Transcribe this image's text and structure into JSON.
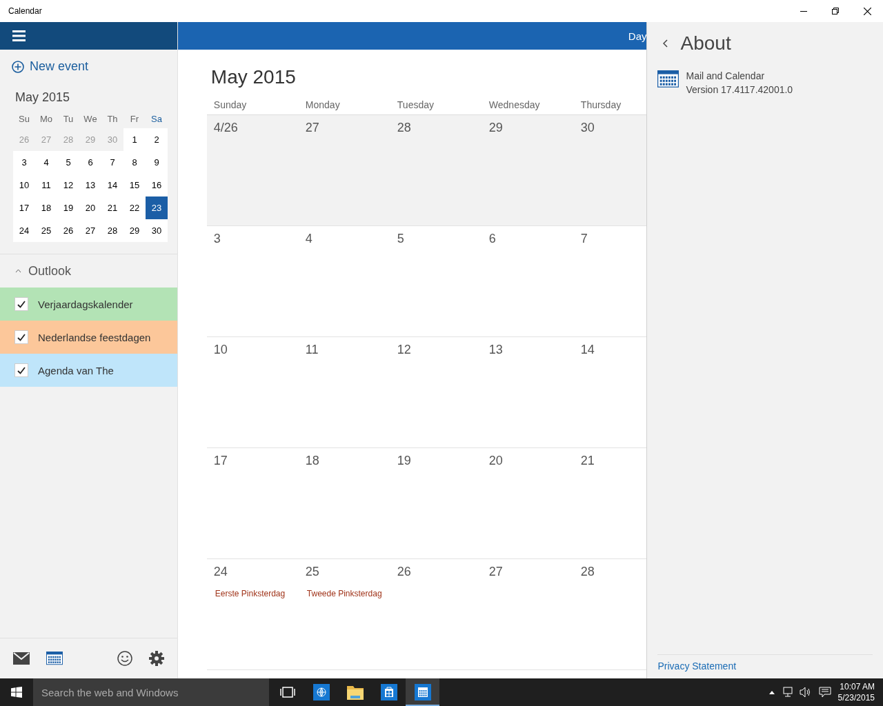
{
  "title_bar": {
    "title": "Calendar",
    "controls": [
      {
        "kind": "minimize"
      },
      {
        "kind": "restore"
      },
      {
        "kind": "close"
      }
    ]
  },
  "sidebar": {
    "new_event": "New event",
    "mini_calendar": {
      "title": "May 2015",
      "weekdays": [
        {
          "label": "Su",
          "highlighted": false
        },
        {
          "label": "Mo",
          "highlighted": false
        },
        {
          "label": "Tu",
          "highlighted": false
        },
        {
          "label": "We",
          "highlighted": false
        },
        {
          "label": "Th",
          "highlighted": false
        },
        {
          "label": "Fr",
          "highlighted": false
        },
        {
          "label": "Sa",
          "highlighted": true
        }
      ],
      "weeks": [
        [
          {
            "label": "26",
            "in_month": false,
            "selected": false
          },
          {
            "label": "27",
            "in_month": false,
            "selected": false
          },
          {
            "label": "28",
            "in_month": false,
            "selected": false
          },
          {
            "label": "29",
            "in_month": false,
            "selected": false
          },
          {
            "label": "30",
            "in_month": false,
            "selected": false
          },
          {
            "label": "1",
            "in_month": true,
            "selected": false
          },
          {
            "label": "2",
            "in_month": true,
            "selected": false
          }
        ],
        [
          {
            "label": "3",
            "in_month": true,
            "selected": false
          },
          {
            "label": "4",
            "in_month": true,
            "selected": false
          },
          {
            "label": "5",
            "in_month": true,
            "selected": false
          },
          {
            "label": "6",
            "in_month": true,
            "selected": false
          },
          {
            "label": "7",
            "in_month": true,
            "selected": false
          },
          {
            "label": "8",
            "in_month": true,
            "selected": false
          },
          {
            "label": "9",
            "in_month": true,
            "selected": false
          }
        ],
        [
          {
            "label": "10",
            "in_month": true,
            "selected": false
          },
          {
            "label": "11",
            "in_month": true,
            "selected": false
          },
          {
            "label": "12",
            "in_month": true,
            "selected": false
          },
          {
            "label": "13",
            "in_month": true,
            "selected": false
          },
          {
            "label": "14",
            "in_month": true,
            "selected": false
          },
          {
            "label": "15",
            "in_month": true,
            "selected": false
          },
          {
            "label": "16",
            "in_month": true,
            "selected": false
          }
        ],
        [
          {
            "label": "17",
            "in_month": true,
            "selected": false
          },
          {
            "label": "18",
            "in_month": true,
            "selected": false
          },
          {
            "label": "19",
            "in_month": true,
            "selected": false
          },
          {
            "label": "20",
            "in_month": true,
            "selected": false
          },
          {
            "label": "21",
            "in_month": true,
            "selected": false
          },
          {
            "label": "22",
            "in_month": true,
            "selected": false
          },
          {
            "label": "23",
            "in_month": true,
            "selected": true
          }
        ],
        [
          {
            "label": "24",
            "in_month": true,
            "selected": false
          },
          {
            "label": "25",
            "in_month": true,
            "selected": false
          },
          {
            "label": "26",
            "in_month": true,
            "selected": false
          },
          {
            "label": "27",
            "in_month": true,
            "selected": false
          },
          {
            "label": "28",
            "in_month": true,
            "selected": false
          },
          {
            "label": "29",
            "in_month": true,
            "selected": false
          },
          {
            "label": "30",
            "in_month": true,
            "selected": false
          }
        ]
      ]
    },
    "account": {
      "name": "Outlook",
      "expanded": true
    },
    "calendars": [
      {
        "name": "Verjaardagskalender",
        "checked": true,
        "color": "#b3e3b5"
      },
      {
        "name": "Nederlandse feestdagen",
        "checked": true,
        "color": "#fcc79a"
      },
      {
        "name": "Agenda van The",
        "checked": true,
        "color": "#bfe5fa"
      }
    ],
    "bottom_icons": [
      {
        "kind": "mail",
        "selected": false
      },
      {
        "kind": "calendar",
        "selected": true
      },
      {
        "kind": "feedback"
      },
      {
        "kind": "settings"
      }
    ]
  },
  "main": {
    "view_label": "Day",
    "title": "May 2015",
    "weekdays": [
      "Sunday",
      "Monday",
      "Tuesday",
      "Wednesday",
      "Thursday"
    ],
    "weeks": [
      [
        {
          "label": "4/26",
          "in_month": false
        },
        {
          "label": "27",
          "in_month": false
        },
        {
          "label": "28",
          "in_month": false
        },
        {
          "label": "29",
          "in_month": false
        },
        {
          "label": "30",
          "in_month": false
        }
      ],
      [
        {
          "label": "3",
          "in_month": true
        },
        {
          "label": "4",
          "in_month": true
        },
        {
          "label": "5",
          "in_month": true
        },
        {
          "label": "6",
          "in_month": true
        },
        {
          "label": "7",
          "in_month": true
        }
      ],
      [
        {
          "label": "10",
          "in_month": true
        },
        {
          "label": "11",
          "in_month": true
        },
        {
          "label": "12",
          "in_month": true
        },
        {
          "label": "13",
          "in_month": true
        },
        {
          "label": "14",
          "in_month": true
        }
      ],
      [
        {
          "label": "17",
          "in_month": true
        },
        {
          "label": "18",
          "in_month": true
        },
        {
          "label": "19",
          "in_month": true
        },
        {
          "label": "20",
          "in_month": true
        },
        {
          "label": "21",
          "in_month": true
        }
      ],
      [
        {
          "label": "24",
          "in_month": true,
          "events": [
            "Eerste Pinksterdag"
          ]
        },
        {
          "label": "25",
          "in_month": true,
          "events": [
            "Tweede Pinksterdag"
          ]
        },
        {
          "label": "26",
          "in_month": true
        },
        {
          "label": "27",
          "in_month": true
        },
        {
          "label": "28",
          "in_month": true
        }
      ]
    ]
  },
  "about_panel": {
    "title": "About",
    "app_name": "Mail and Calendar",
    "version": "Version 17.4117.42001.0",
    "privacy_link": "Privacy Statement"
  },
  "taskbar": {
    "search": {
      "placeholder": "Search the web and Windows"
    },
    "apps": [
      {
        "kind": "task-view",
        "selected": false
      },
      {
        "kind": "browser",
        "selected": false
      },
      {
        "kind": "folder",
        "selected": false
      },
      {
        "kind": "store",
        "selected": false
      },
      {
        "kind": "calendar",
        "selected": true
      }
    ],
    "tray": {
      "time": "10:07 AM",
      "date": "5/23/2015"
    }
  }
}
